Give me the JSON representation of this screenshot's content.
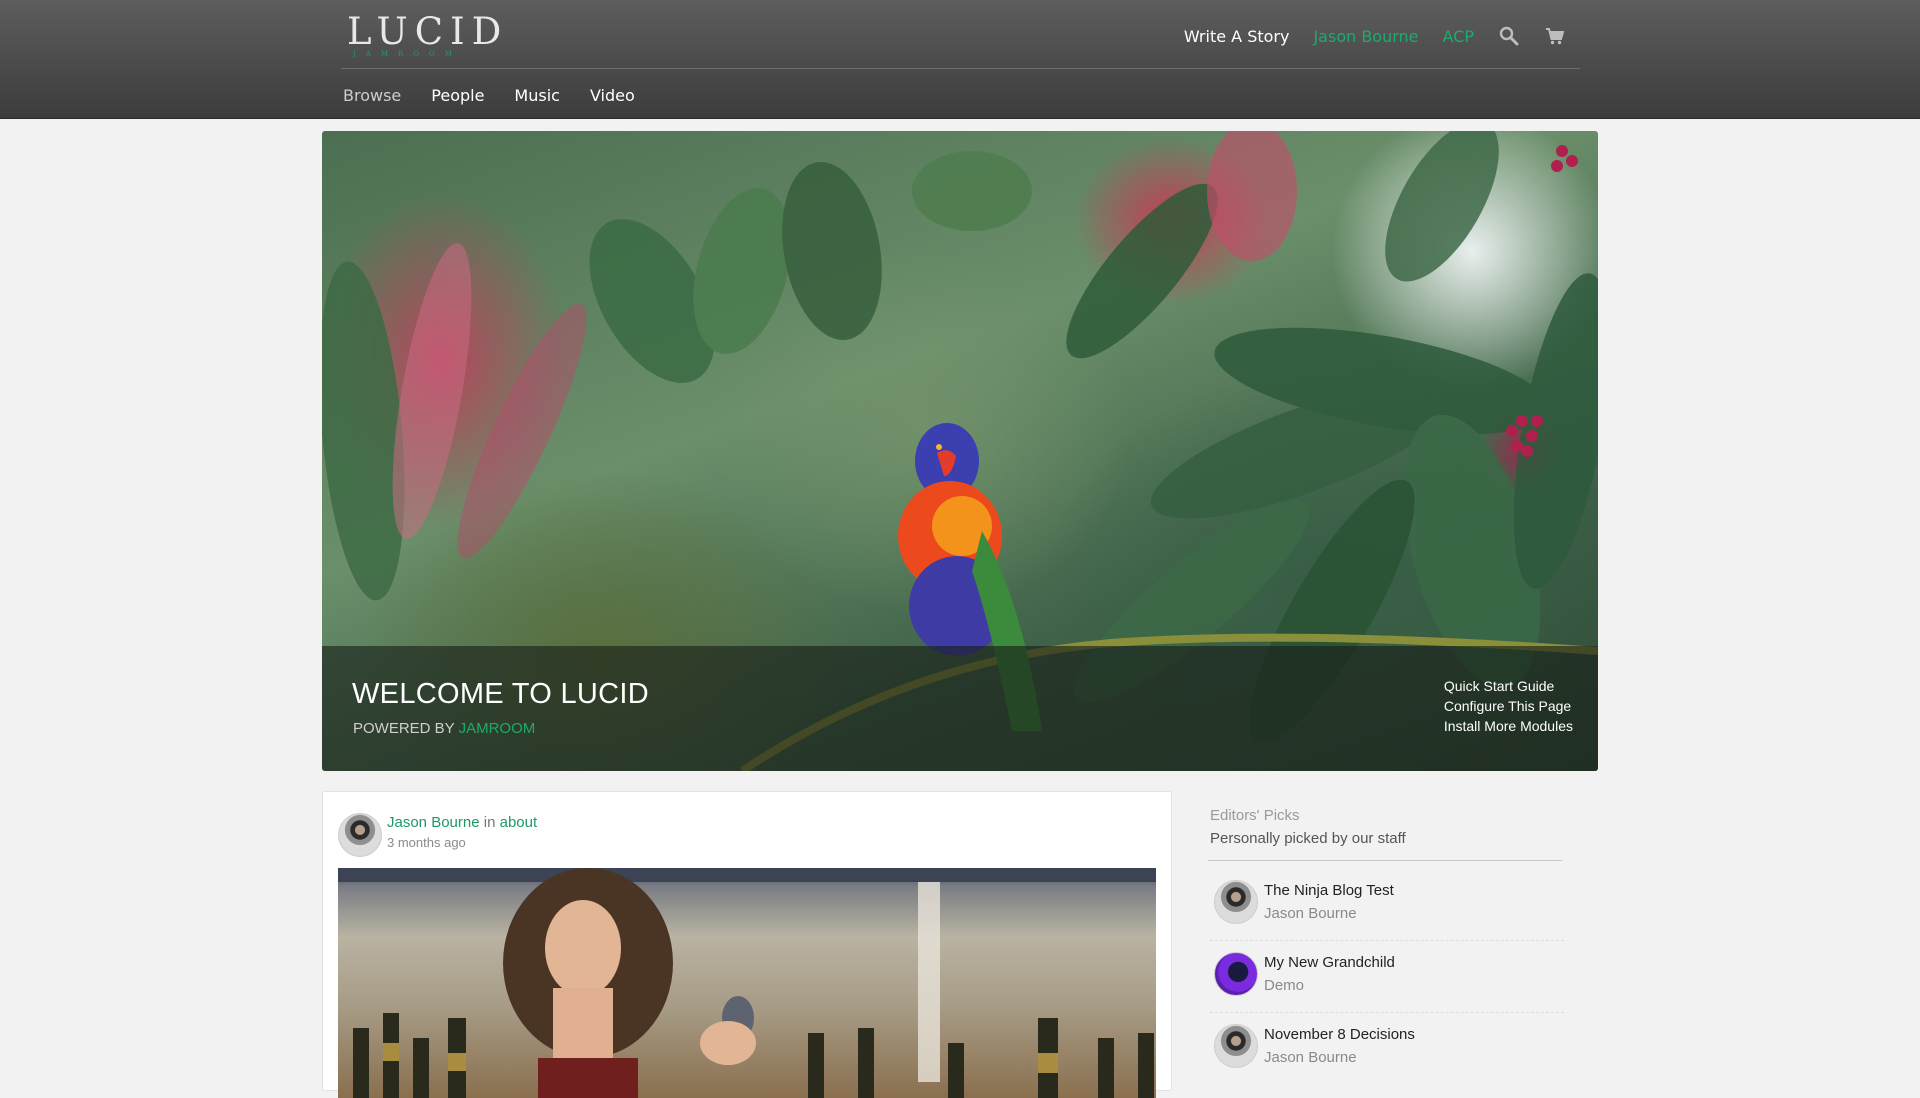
{
  "header": {
    "logo_main": "LUCID",
    "logo_sub": "JAMROOM",
    "topnav": {
      "write_story": "Write A Story",
      "user_name": "Jason Bourne",
      "acp": "ACP",
      "search_icon": "search-icon",
      "cart_icon": "cart-icon"
    },
    "subnav": [
      {
        "label": "Browse"
      },
      {
        "label": "People"
      },
      {
        "label": "Music"
      },
      {
        "label": "Video"
      }
    ]
  },
  "hero": {
    "title": "WELCOME TO LUCID",
    "powered_prefix": "POWERED BY",
    "powered_link": "JAMROOM",
    "links": [
      "Quick Start Guide",
      "Configure This Page",
      "Install More Modules"
    ]
  },
  "post": {
    "author": "Jason Bourne",
    "in_word": "in",
    "category": "about",
    "time": "3 months ago"
  },
  "sidebar": {
    "title": "Editors' Picks",
    "subtitle": "Personally picked by our staff",
    "picks": [
      {
        "title": "The Ninja Blog Test",
        "author": "Jason Bourne",
        "avatar": "jason"
      },
      {
        "title": "My New Grandchild",
        "author": "Demo",
        "avatar": "demo"
      },
      {
        "title": "November 8 Decisions",
        "author": "Jason Bourne",
        "avatar": "jason"
      }
    ]
  },
  "colors": {
    "accent_green": "#1cab6d",
    "header_bg": "#4a4a4a",
    "page_bg": "#f2f2f2"
  }
}
